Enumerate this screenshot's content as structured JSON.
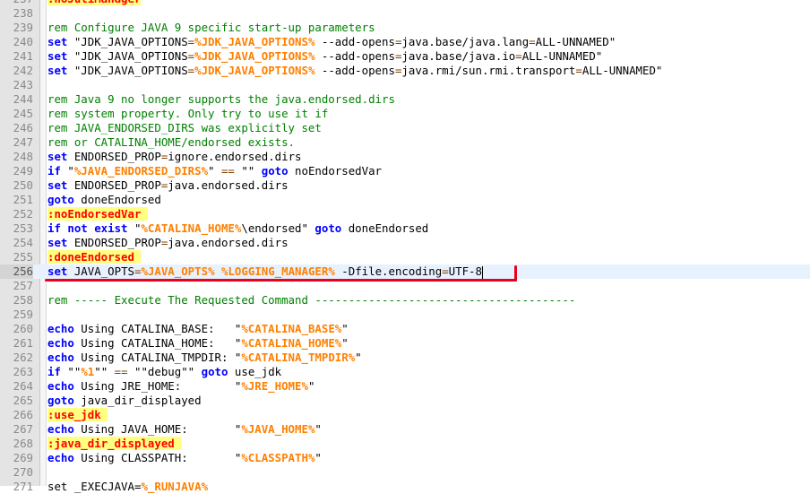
{
  "editor": {
    "lines": [
      {
        "n": "237",
        "tokens": [
          {
            "c": "lbl",
            "t": ":noJuliManager"
          }
        ]
      },
      {
        "n": "238",
        "tokens": []
      },
      {
        "n": "239",
        "tokens": [
          {
            "c": "cmt",
            "t": "rem Configure JAVA 9 specific start-up parameters"
          }
        ]
      },
      {
        "n": "240",
        "tokens": [
          {
            "c": "kw",
            "t": "set"
          },
          {
            "c": "",
            "t": " \"JDK_JAVA_OPTIONS"
          },
          {
            "c": "op",
            "t": "="
          },
          {
            "c": "var",
            "t": "%JDK_JAVA_OPTIONS%"
          },
          {
            "c": "",
            "t": " --add-opens"
          },
          {
            "c": "op",
            "t": "="
          },
          {
            "c": "",
            "t": "java.base/java.lang"
          },
          {
            "c": "op",
            "t": "="
          },
          {
            "c": "",
            "t": "ALL-UNNAMED\""
          }
        ]
      },
      {
        "n": "241",
        "tokens": [
          {
            "c": "kw",
            "t": "set"
          },
          {
            "c": "",
            "t": " \"JDK_JAVA_OPTIONS"
          },
          {
            "c": "op",
            "t": "="
          },
          {
            "c": "var",
            "t": "%JDK_JAVA_OPTIONS%"
          },
          {
            "c": "",
            "t": " --add-opens"
          },
          {
            "c": "op",
            "t": "="
          },
          {
            "c": "",
            "t": "java.base/java.io"
          },
          {
            "c": "op",
            "t": "="
          },
          {
            "c": "",
            "t": "ALL-UNNAMED\""
          }
        ]
      },
      {
        "n": "242",
        "tokens": [
          {
            "c": "kw",
            "t": "set"
          },
          {
            "c": "",
            "t": " \"JDK_JAVA_OPTIONS"
          },
          {
            "c": "op",
            "t": "="
          },
          {
            "c": "var",
            "t": "%JDK_JAVA_OPTIONS%"
          },
          {
            "c": "",
            "t": " --add-opens"
          },
          {
            "c": "op",
            "t": "="
          },
          {
            "c": "",
            "t": "java.rmi/sun.rmi.transport"
          },
          {
            "c": "op",
            "t": "="
          },
          {
            "c": "",
            "t": "ALL-UNNAMED\""
          }
        ]
      },
      {
        "n": "243",
        "tokens": []
      },
      {
        "n": "244",
        "tokens": [
          {
            "c": "cmt",
            "t": "rem Java 9 no longer supports the java.endorsed.dirs"
          }
        ]
      },
      {
        "n": "245",
        "tokens": [
          {
            "c": "cmt",
            "t": "rem system property. Only try to use it if"
          }
        ]
      },
      {
        "n": "246",
        "tokens": [
          {
            "c": "cmt",
            "t": "rem JAVA_ENDORSED_DIRS was explicitly set"
          }
        ]
      },
      {
        "n": "247",
        "tokens": [
          {
            "c": "cmt",
            "t": "rem or CATALINA_HOME/endorsed exists."
          }
        ]
      },
      {
        "n": "248",
        "tokens": [
          {
            "c": "kw",
            "t": "set"
          },
          {
            "c": "",
            "t": " ENDORSED_PROP"
          },
          {
            "c": "op",
            "t": "="
          },
          {
            "c": "",
            "t": "ignore.endorsed.dirs"
          }
        ]
      },
      {
        "n": "249",
        "tokens": [
          {
            "c": "kw",
            "t": "if"
          },
          {
            "c": "",
            "t": " \""
          },
          {
            "c": "var",
            "t": "%JAVA_ENDORSED_DIRS%"
          },
          {
            "c": "",
            "t": "\" "
          },
          {
            "c": "op",
            "t": "=="
          },
          {
            "c": "",
            "t": " \"\" "
          },
          {
            "c": "kw",
            "t": "goto"
          },
          {
            "c": "",
            "t": " noEndorsedVar"
          }
        ]
      },
      {
        "n": "250",
        "tokens": [
          {
            "c": "kw",
            "t": "set"
          },
          {
            "c": "",
            "t": " ENDORSED_PROP"
          },
          {
            "c": "op",
            "t": "="
          },
          {
            "c": "",
            "t": "java.endorsed.dirs"
          }
        ]
      },
      {
        "n": "251",
        "tokens": [
          {
            "c": "kw",
            "t": "goto"
          },
          {
            "c": "",
            "t": " doneEndorsed"
          }
        ]
      },
      {
        "n": "252",
        "tokens": [
          {
            "c": "lbl",
            "t": ":noEndorsedVar "
          }
        ]
      },
      {
        "n": "253",
        "tokens": [
          {
            "c": "kw",
            "t": "if not exist"
          },
          {
            "c": "",
            "t": " \""
          },
          {
            "c": "var",
            "t": "%CATALINA_HOME%"
          },
          {
            "c": "",
            "t": "\\endorsed\" "
          },
          {
            "c": "kw",
            "t": "goto"
          },
          {
            "c": "",
            "t": " doneEndorsed"
          }
        ]
      },
      {
        "n": "254",
        "tokens": [
          {
            "c": "kw",
            "t": "set"
          },
          {
            "c": "",
            "t": " ENDORSED_PROP"
          },
          {
            "c": "op",
            "t": "="
          },
          {
            "c": "",
            "t": "java.endorsed.dirs"
          }
        ]
      },
      {
        "n": "255",
        "tokens": [
          {
            "c": "lbl",
            "t": ":doneEndorsed "
          }
        ]
      },
      {
        "n": "256",
        "current": true,
        "tokens": [
          {
            "c": "kw",
            "t": "set"
          },
          {
            "c": "",
            "t": " JAVA_OPTS"
          },
          {
            "c": "op",
            "t": "="
          },
          {
            "c": "var",
            "t": "%JAVA_OPTS%"
          },
          {
            "c": "",
            "t": " "
          },
          {
            "c": "var",
            "t": "%LOGGING_MANAGER%"
          },
          {
            "c": "",
            "t": " -Dfile.encoding"
          },
          {
            "c": "op",
            "t": "="
          },
          {
            "c": "",
            "t": "UTF-8"
          }
        ]
      },
      {
        "n": "257",
        "tokens": []
      },
      {
        "n": "258",
        "tokens": [
          {
            "c": "cmt",
            "t": "rem ----- Execute The Requested Command ---------------------------------------"
          }
        ]
      },
      {
        "n": "259",
        "tokens": []
      },
      {
        "n": "260",
        "tokens": [
          {
            "c": "kw",
            "t": "echo"
          },
          {
            "c": "",
            "t": " Using CATALINA_BASE:   \""
          },
          {
            "c": "var",
            "t": "%CATALINA_BASE%"
          },
          {
            "c": "",
            "t": "\""
          }
        ]
      },
      {
        "n": "261",
        "tokens": [
          {
            "c": "kw",
            "t": "echo"
          },
          {
            "c": "",
            "t": " Using CATALINA_HOME:   \""
          },
          {
            "c": "var",
            "t": "%CATALINA_HOME%"
          },
          {
            "c": "",
            "t": "\""
          }
        ]
      },
      {
        "n": "262",
        "tokens": [
          {
            "c": "kw",
            "t": "echo"
          },
          {
            "c": "",
            "t": " Using CATALINA_TMPDIR: \""
          },
          {
            "c": "var",
            "t": "%CATALINA_TMPDIR%"
          },
          {
            "c": "",
            "t": "\""
          }
        ]
      },
      {
        "n": "263",
        "tokens": [
          {
            "c": "kw",
            "t": "if"
          },
          {
            "c": "",
            "t": " \"\""
          },
          {
            "c": "var",
            "t": "%1"
          },
          {
            "c": "",
            "t": "\"\" "
          },
          {
            "c": "op",
            "t": "=="
          },
          {
            "c": "",
            "t": " \"\"debug\"\" "
          },
          {
            "c": "kw",
            "t": "goto"
          },
          {
            "c": "",
            "t": " use_jdk"
          }
        ]
      },
      {
        "n": "264",
        "tokens": [
          {
            "c": "kw",
            "t": "echo"
          },
          {
            "c": "",
            "t": " Using JRE_HOME:        \""
          },
          {
            "c": "var",
            "t": "%JRE_HOME%"
          },
          {
            "c": "",
            "t": "\""
          }
        ]
      },
      {
        "n": "265",
        "tokens": [
          {
            "c": "kw",
            "t": "goto"
          },
          {
            "c": "",
            "t": " java_dir_displayed"
          }
        ]
      },
      {
        "n": "266",
        "tokens": [
          {
            "c": "lbl",
            "t": ":use_jdk "
          }
        ]
      },
      {
        "n": "267",
        "tokens": [
          {
            "c": "kw",
            "t": "echo"
          },
          {
            "c": "",
            "t": " Using JAVA_HOME:       \""
          },
          {
            "c": "var",
            "t": "%JAVA_HOME%"
          },
          {
            "c": "",
            "t": "\""
          }
        ]
      },
      {
        "n": "268",
        "tokens": [
          {
            "c": "lbl",
            "t": ":java_dir_displayed "
          }
        ]
      },
      {
        "n": "269",
        "tokens": [
          {
            "c": "kw",
            "t": "echo"
          },
          {
            "c": "",
            "t": " Using CLASSPATH:       \""
          },
          {
            "c": "var",
            "t": "%CLASSPATH%"
          },
          {
            "c": "",
            "t": "\""
          }
        ]
      },
      {
        "n": "270",
        "tokens": []
      },
      {
        "n": "271",
        "tokens": [
          {
            "c": "",
            "t": "set _EXECJAVA="
          },
          {
            "c": "var",
            "t": "%_RUNJAVA%"
          }
        ]
      }
    ]
  }
}
